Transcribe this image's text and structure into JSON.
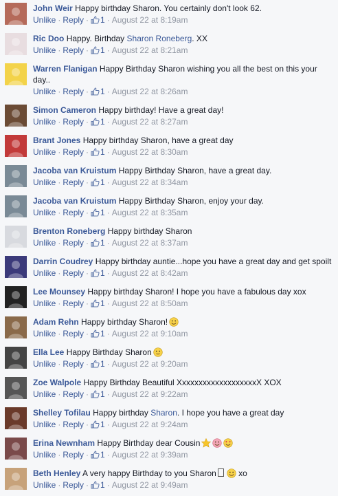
{
  "ui": {
    "unlike_label": "Unlike",
    "reply_label": "Reply",
    "dot": "·",
    "like_icon": "thumbs-up-icon"
  },
  "comments": [
    {
      "author": "John Weir",
      "text": "Happy birthday Sharon. You certainly don't look 62.",
      "likes": "1",
      "time": "August 22 at 8:19am",
      "avatar": "#b56a5a"
    },
    {
      "author": "Ric Doo",
      "text_before": "Happy. Birthday",
      "mention": "Sharon Roneberg",
      "text_after": ". XX",
      "likes": "1",
      "time": "August 22 at 8:21am",
      "avatar": "#e8dde0"
    },
    {
      "author": "Warren Flanigan",
      "text": "Happy Birthday Sharon wishing you all the best on this your day..",
      "likes": "1",
      "time": "August 22 at 8:26am",
      "avatar": "#f3d34a"
    },
    {
      "author": "Simon Cameron",
      "text": "Happy birthday! Have a great day!",
      "likes": "1",
      "time": "August 22 at 8:27am",
      "avatar": "#6b4b35"
    },
    {
      "author": "Brant Jones",
      "text": "Happy birthday Sharon, have a great day",
      "likes": "1",
      "time": "August 22 at 8:30am",
      "avatar": "#c23a3a"
    },
    {
      "author": "Jacoba van Kruistum",
      "text": "Happy Birthday Sharon, have a great day.",
      "likes": "1",
      "time": "August 22 at 8:34am",
      "avatar": "#7a8a96"
    },
    {
      "author": "Jacoba van Kruistum",
      "text": "Happy Birthday Sharon, enjoy your day.",
      "likes": "1",
      "time": "August 22 at 8:35am",
      "avatar": "#7a8a96"
    },
    {
      "author": "Brenton Roneberg",
      "text": "Happy birthday Sharon",
      "likes": "1",
      "time": "August 22 at 8:37am",
      "avatar": "#d8dadf"
    },
    {
      "author": "Darrin Coudrey",
      "text": "Happy birthday auntie...hope you have a great day and get spoilt",
      "likes": "1",
      "time": "August 22 at 8:42am",
      "avatar": "#3b3a7a"
    },
    {
      "author": "Lee Mounsey",
      "text": "Happy birthday Sharon! I hope you have a fabulous day xox",
      "likes": "1",
      "time": "August 22 at 8:50am",
      "avatar": "#222222"
    },
    {
      "author": "Adam Rehn",
      "text": "Happy birthday Sharon!",
      "emojis": [
        "smile-emoji"
      ],
      "likes": "1",
      "time": "August 22 at 9:10am",
      "avatar": "#8a6a4a"
    },
    {
      "author": "Ella Lee",
      "text": "Happy Birthday Sharon",
      "emojis": [
        "slight-smile-emoji"
      ],
      "likes": "1",
      "time": "August 22 at 9:20am",
      "avatar": "#444444"
    },
    {
      "author": "Zoe Walpole",
      "text": "Happy Birthday Beautiful XxxxxxxxxxxxxxxxxxxX XOX",
      "likes": "1",
      "time": "August 22 at 9:22am",
      "avatar": "#555555"
    },
    {
      "author": "Shelley Tofilau",
      "text_before": "Happy birthday",
      "mention": "Sharon",
      "text_after": ". I hope you have a great day",
      "likes": "1",
      "time": "August 22 at 9:24am",
      "avatar": "#6a3a2a"
    },
    {
      "author": "Erina Newnham",
      "text": "Happy Birthday dear Cousin",
      "emojis": [
        "star-emoji",
        "heart-face-emoji",
        "heart-eyes-emoji"
      ],
      "likes": "1",
      "time": "August 22 at 9:39am",
      "avatar": "#7a4a4a"
    },
    {
      "author": "Beth Henley",
      "text": "A very happy Birthday to you Sharon",
      "after_box": "xo",
      "emojis": [
        "smile-emoji"
      ],
      "likes": "1",
      "time": "August 22 at 9:49am",
      "avatar": "#c7a27a"
    }
  ]
}
